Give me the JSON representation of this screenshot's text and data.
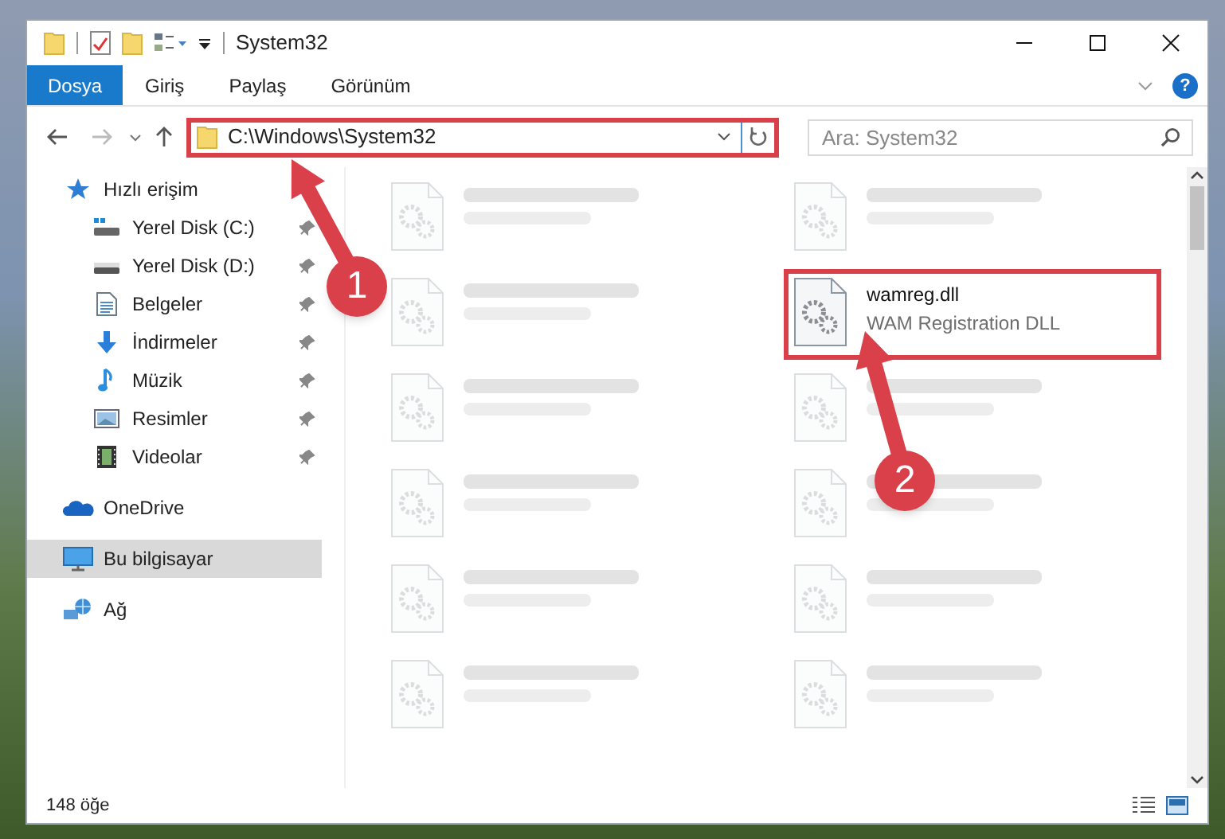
{
  "window": {
    "title": "System32"
  },
  "ribbon": {
    "tabs": [
      {
        "label": "Dosya",
        "selected": true
      },
      {
        "label": "Giriş",
        "selected": false
      },
      {
        "label": "Paylaş",
        "selected": false
      },
      {
        "label": "Görünüm",
        "selected": false
      }
    ],
    "help_button": "?"
  },
  "address_bar": {
    "path": "C:\\Windows\\System32",
    "highlighted": true
  },
  "search": {
    "placeholder": "Ara: System32"
  },
  "sidebar": {
    "items": [
      {
        "label": "Hızlı erişim",
        "kind": "star",
        "selected": false,
        "children": [
          {
            "label": "Yerel Disk (C:)",
            "kind": "system-drive",
            "pinned": true,
            "selected": false
          },
          {
            "label": "Yerel Disk (D:)",
            "kind": "drive",
            "pinned": true,
            "selected": false
          },
          {
            "label": "Belgeler",
            "kind": "documents",
            "pinned": true,
            "selected": false
          },
          {
            "label": "İndirmeler",
            "kind": "downloads",
            "pinned": true,
            "selected": false
          },
          {
            "label": "Müzik",
            "kind": "music",
            "pinned": true,
            "selected": false
          },
          {
            "label": "Resimler",
            "kind": "pictures",
            "pinned": true,
            "selected": false
          },
          {
            "label": "Videolar",
            "kind": "videos",
            "pinned": true,
            "selected": false
          }
        ]
      },
      {
        "label": "OneDrive",
        "kind": "cloud",
        "selected": false
      },
      {
        "label": "Bu bilgisayar",
        "kind": "computer",
        "selected": true
      },
      {
        "label": "Ağ",
        "kind": "network",
        "selected": false
      }
    ]
  },
  "files": [
    {
      "faded": true
    },
    {
      "faded": true
    },
    {
      "faded": true
    },
    {
      "name": "wamreg.dll",
      "type": "WAM Registration DLL",
      "faded": false,
      "highlighted": true
    },
    {
      "faded": true
    },
    {
      "faded": true
    },
    {
      "faded": true
    },
    {
      "faded": true
    },
    {
      "faded": true
    },
    {
      "faded": true
    },
    {
      "faded": true
    },
    {
      "faded": true
    }
  ],
  "status_bar": {
    "item_count": "148 öğe"
  },
  "annotations": [
    {
      "label": "1"
    },
    {
      "label": "2"
    }
  ]
}
